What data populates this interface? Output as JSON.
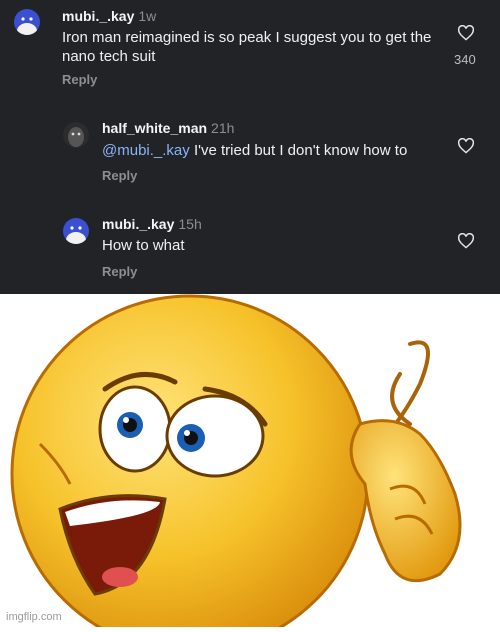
{
  "comments": [
    {
      "username": "mubi._.kay",
      "time": "1w",
      "mention": "",
      "text": "Iron man reimagined is so peak I suggest you to get the nano tech suit",
      "reply_label": "Reply",
      "likes": "340",
      "avatar": "blue-creature-avatar"
    },
    {
      "username": "half_white_man",
      "time": "21h",
      "mention": "@mubi._.kay",
      "text": "I've tried but I don't know how to",
      "reply_label": "Reply",
      "likes": "",
      "avatar": "dark-creature-avatar"
    },
    {
      "username": "mubi._.kay",
      "time": "15h",
      "mention": "",
      "text": "How to what",
      "reply_label": "Reply",
      "likes": "",
      "avatar": "blue-creature-avatar"
    }
  ],
  "image": {
    "subject": "confused-thinking-emoji"
  },
  "watermark": "imgflip.com",
  "colors": {
    "background": "#212327",
    "mention": "#8ab4f8",
    "muted": "#8e8e8e"
  }
}
